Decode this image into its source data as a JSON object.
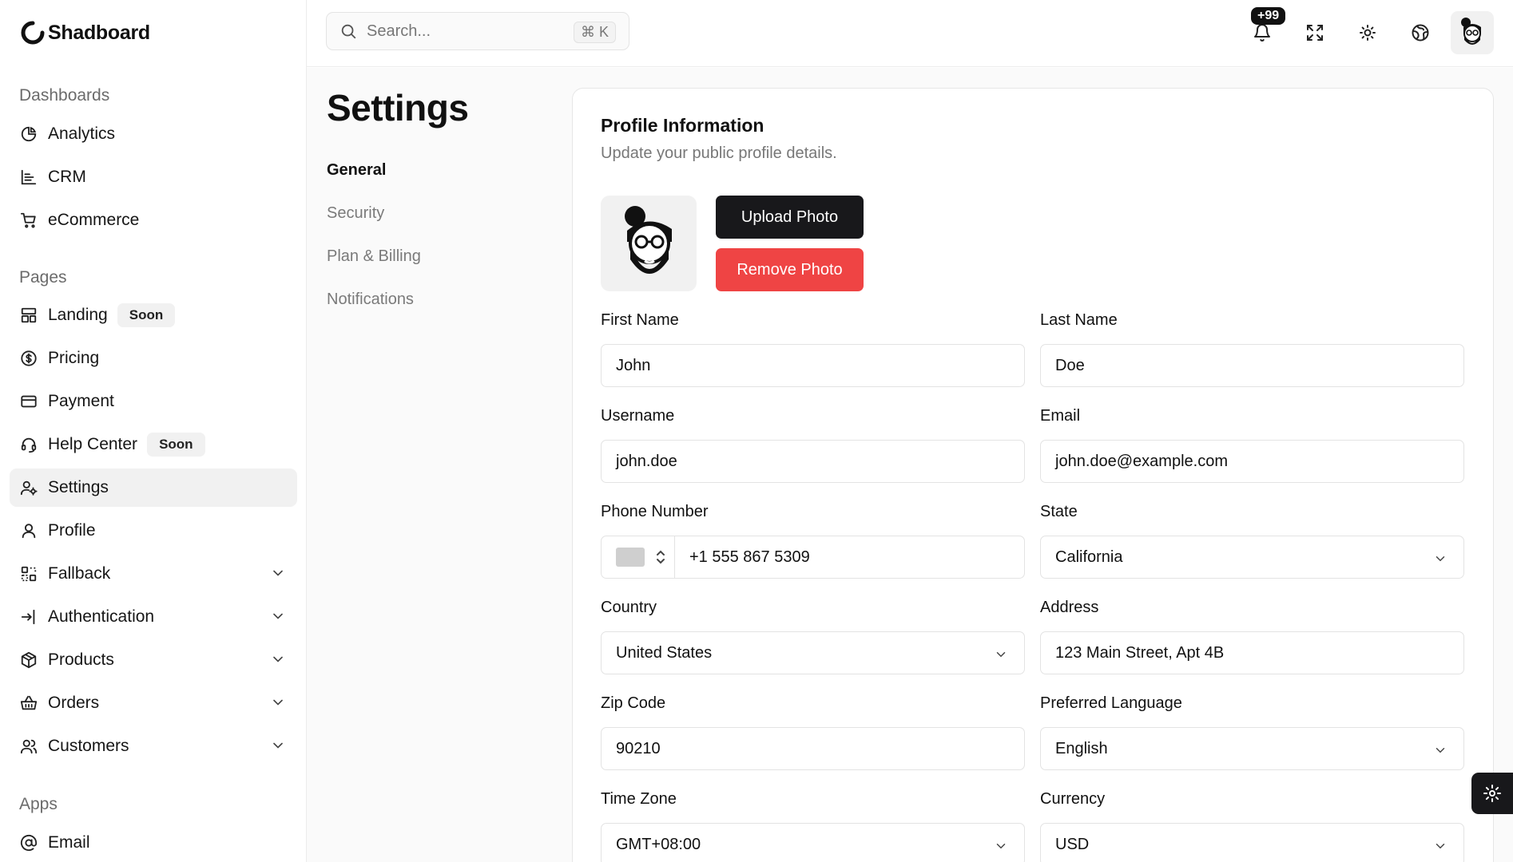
{
  "brand": {
    "name": "Shadboard"
  },
  "search": {
    "placeholder": "Search...",
    "shortcut": "⌘ K"
  },
  "notifications": {
    "count": "+99"
  },
  "sidebar": {
    "sections": [
      {
        "title": "Dashboards"
      },
      {
        "title": "Pages"
      },
      {
        "title": "Apps"
      }
    ],
    "items": [
      {
        "label": "Analytics",
        "icon": "pie-chart-icon"
      },
      {
        "label": "CRM",
        "icon": "bar-chart-icon"
      },
      {
        "label": "eCommerce",
        "icon": "shopping-cart-icon"
      },
      {
        "label": "Landing",
        "icon": "layout-icon",
        "badge": "Soon"
      },
      {
        "label": "Pricing",
        "icon": "dollar-circle-icon"
      },
      {
        "label": "Payment",
        "icon": "credit-card-icon"
      },
      {
        "label": "Help Center",
        "icon": "headset-icon",
        "badge": "Soon"
      },
      {
        "label": "Settings",
        "icon": "user-cog-icon",
        "active": true
      },
      {
        "label": "Profile",
        "icon": "user-icon"
      },
      {
        "label": "Fallback",
        "icon": "fallback-icon",
        "expandable": true
      },
      {
        "label": "Authentication",
        "icon": "login-icon",
        "expandable": true
      },
      {
        "label": "Products",
        "icon": "package-icon",
        "expandable": true
      },
      {
        "label": "Orders",
        "icon": "basket-icon",
        "expandable": true
      },
      {
        "label": "Customers",
        "icon": "users-icon",
        "expandable": true
      },
      {
        "label": "Email",
        "icon": "at-sign-icon"
      }
    ]
  },
  "page": {
    "title": "Settings",
    "sub_nav": [
      {
        "label": "General",
        "active": true
      },
      {
        "label": "Security"
      },
      {
        "label": "Plan & Billing"
      },
      {
        "label": "Notifications"
      }
    ]
  },
  "profile": {
    "title": "Profile Information",
    "subtitle": "Update your public profile details.",
    "upload_label": "Upload Photo",
    "remove_label": "Remove Photo",
    "fields": {
      "first_name": {
        "label": "First Name",
        "value": "John"
      },
      "last_name": {
        "label": "Last Name",
        "value": "Doe"
      },
      "username": {
        "label": "Username",
        "value": "john.doe"
      },
      "email": {
        "label": "Email",
        "value": "john.doe@example.com"
      },
      "phone": {
        "label": "Phone Number",
        "value": "+1 555 867 5309"
      },
      "state": {
        "label": "State",
        "value": "California"
      },
      "country": {
        "label": "Country",
        "value": "United States"
      },
      "address": {
        "label": "Address",
        "value": "123 Main Street, Apt 4B"
      },
      "zip": {
        "label": "Zip Code",
        "value": "90210"
      },
      "language": {
        "label": "Preferred Language",
        "value": "English"
      },
      "timezone": {
        "label": "Time Zone",
        "value": "GMT+08:00"
      },
      "currency": {
        "label": "Currency",
        "value": "USD"
      }
    }
  },
  "colors": {
    "primary": "#18181b",
    "danger": "#ef4444",
    "active_bg": "#f1f1f1"
  }
}
